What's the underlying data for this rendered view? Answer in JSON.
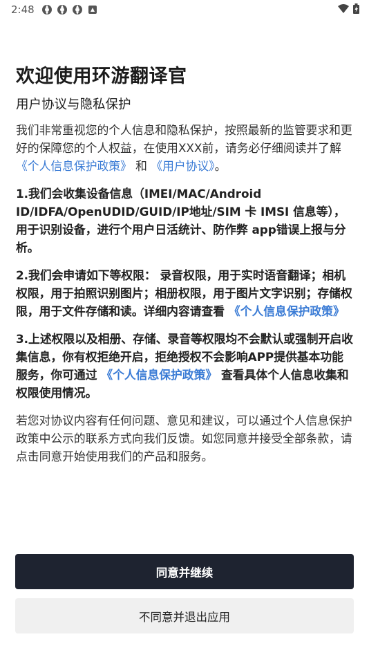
{
  "status": {
    "time": "2:48"
  },
  "title": "欢迎使用环游翻译官",
  "subtitle": "用户协议与隐私保护",
  "intro": {
    "text1": "我们非常重视您的个人信息和隐私保护，按照最新的监管要求和更好的保障您的个人权益，在使用XXX前，请务必仔细阅读并了解 ",
    "link1": "《个人信息保护政策》",
    "text2": " 和 ",
    "link2": "《用户协议》",
    "text3": "。"
  },
  "item1": "1.我们会收集设备信息（IMEI/MAC/Android ID/IDFA/OpenUDID/GUID/IP地址/SIM 卡 IMSI 信息等），用于识别设备，进行个用户日活统计、防作弊 app错误上报与分析。",
  "item2": {
    "text": "2.我们会申请如下等权限： 录音权限，用于实时语音翻译；相机权限，用于拍照识别图片；相册权限，用于图片文字识别；存储权限，用于文件存储和读。详细内容请查看 ",
    "link": "《个人信息保护政策》"
  },
  "item3": {
    "text1": "3.上述权限以及相册、存储、录音等权限均不会默认或强制开启收集信息，你有权拒绝开启，拒绝授权不会影响APP提供基本功能服务，你可通过 ",
    "link": "《个人信息保护政策》",
    "text2": " 查看具体个人信息收集和权限使用情况。"
  },
  "closing": "若您对协议内容有任何问题、意见和建议，可以通过个人信息保护政策中公示的联系方式向我们反馈。如您同意并接受全部条款，请点击同意开始使用我们的产品和服务。",
  "buttons": {
    "agree": "同意并继续",
    "disagree": "不同意并退出应用"
  },
  "colors": {
    "link": "#3a7bd5",
    "primary_button": "#1e2330",
    "secondary_button": "#f0f0f0"
  }
}
